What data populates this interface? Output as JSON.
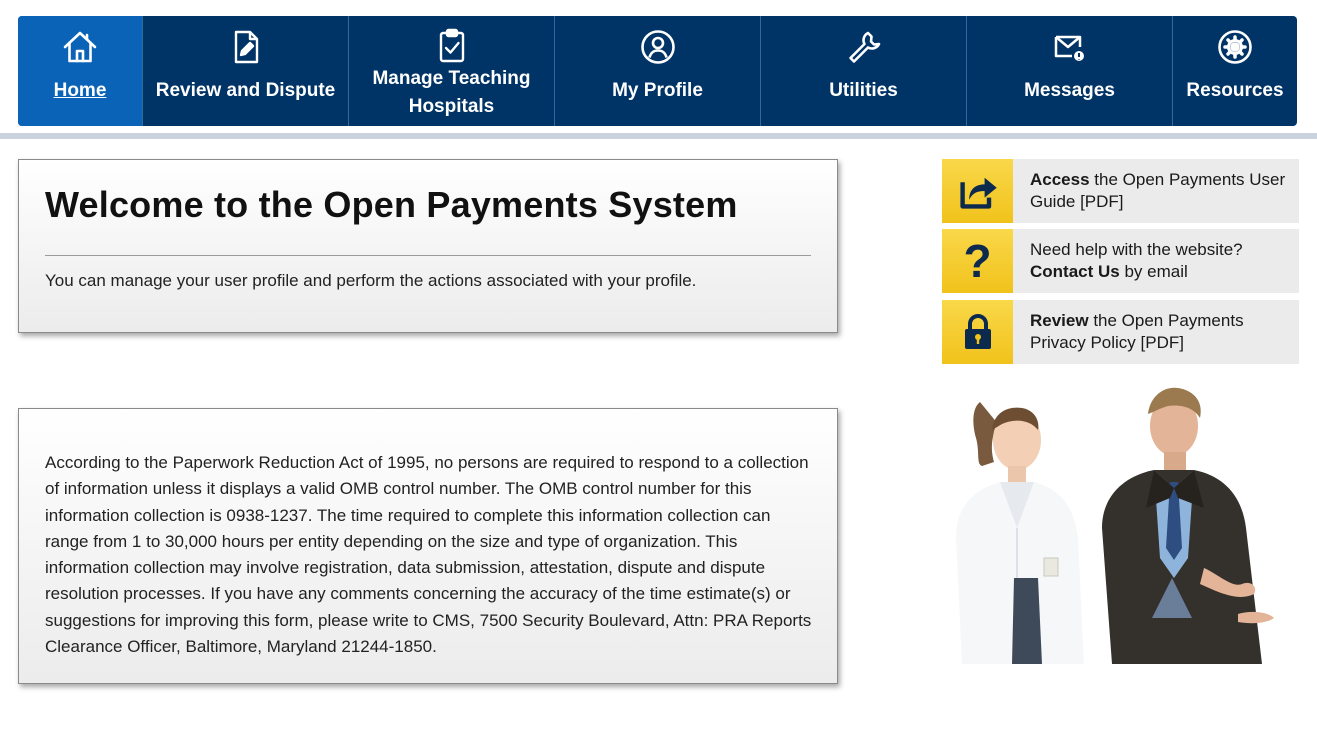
{
  "nav": {
    "items": [
      {
        "label": "Home",
        "icon": "home-icon",
        "active": true
      },
      {
        "label": "Review and Dispute",
        "icon": "document-edit-icon"
      },
      {
        "label": "Manage Teaching Hospitals",
        "icon": "clipboard-check-icon"
      },
      {
        "label": "My Profile",
        "icon": "user-circle-icon"
      },
      {
        "label": "Utilities",
        "icon": "wrench-icon"
      },
      {
        "label": "Messages",
        "icon": "envelope-icon"
      },
      {
        "label": "Resources",
        "icon": "gear-icon"
      }
    ]
  },
  "welcome": {
    "title": "Welcome to the Open Payments System",
    "text": "You can manage your user profile and perform the actions associated with your profile."
  },
  "pra": {
    "text": "According to the Paperwork Reduction Act of 1995, no persons are required to respond to a collection of information unless it displays a valid OMB control number. The OMB control number for this information collection is 0938-1237. The time required to complete this information collection can range from 1 to 30,000 hours per entity depending on the size and type of organization. This information collection may involve registration, data submission, attestation, dispute and dispute resolution processes. If you have any comments concerning the accuracy of the time estimate(s) or suggestions for improving this form, please write to CMS, 7500 Security Boulevard, Attn: PRA Reports Clearance Officer, Baltimore, Maryland 21244-1850."
  },
  "quick_links": [
    {
      "bold": "Access",
      "rest": " the Open Payments User Guide [PDF]",
      "icon": "share-arrow-icon"
    },
    {
      "pre": "Need help with the website? ",
      "bold": "Contact Us",
      "rest": " by email",
      "icon": "question-mark-icon"
    },
    {
      "bold": "Review",
      "rest": " the Open Payments Privacy Policy [PDF]",
      "icon": "lock-icon"
    }
  ],
  "colors": {
    "nav_bg": "#003366",
    "nav_active": "#0b63b8",
    "accent_yellow": "#f1c21b",
    "icon_navy": "#0b2a4e"
  }
}
